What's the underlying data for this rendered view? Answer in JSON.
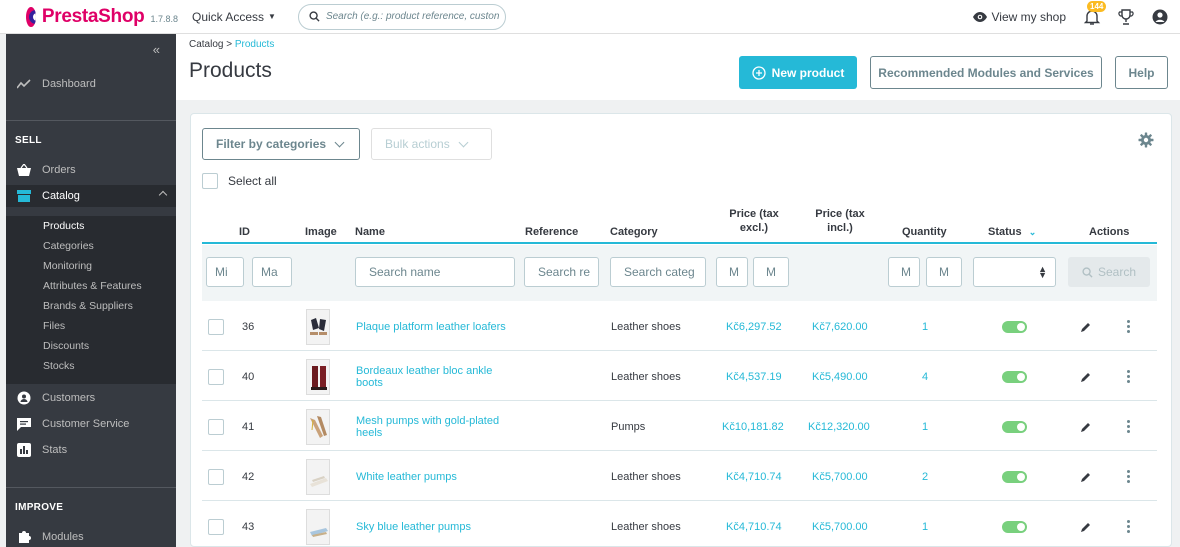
{
  "topbar": {
    "logo_text": "PrestaShop",
    "version": "1.7.8.8",
    "quick_access": "Quick Access",
    "search_placeholder": "Search (e.g.: product reference, custon",
    "view_shop": "View my shop",
    "notifications_count": "144"
  },
  "sidebar": {
    "dashboard": "Dashboard",
    "sell_heading": "SELL",
    "orders": "Orders",
    "catalog": "Catalog",
    "catalog_sub": [
      "Products",
      "Categories",
      "Monitoring",
      "Attributes & Features",
      "Brands & Suppliers",
      "Files",
      "Discounts",
      "Stocks"
    ],
    "customers": "Customers",
    "customer_service": "Customer Service",
    "stats": "Stats",
    "improve_heading": "IMPROVE",
    "modules": "Modules"
  },
  "header": {
    "breadcrumb_parent": "Catalog",
    "breadcrumb_sep": ">",
    "breadcrumb_current": "Products",
    "title": "Products",
    "new_product": "New product",
    "recommended": "Recommended Modules and Services",
    "help": "Help"
  },
  "toolbar": {
    "filter_categories": "Filter by categories",
    "bulk_actions": "Bulk actions",
    "select_all": "Select all"
  },
  "table": {
    "headers": {
      "id": "ID",
      "image": "Image",
      "name": "Name",
      "reference": "Reference",
      "category": "Category",
      "price_excl_1": "Price (tax",
      "price_excl_2": "excl.)",
      "price_incl_1": "Price (tax",
      "price_incl_2": "incl.)",
      "quantity": "Quantity",
      "status": "Status",
      "actions": "Actions"
    },
    "filters": {
      "id_min": "Mi",
      "id_max": "Ma",
      "name": "Search name",
      "reference": "Search re",
      "category": "Search categ",
      "price_min": "M",
      "price_max": "M",
      "qty_min": "M",
      "qty_max": "M",
      "search_button": "Search"
    },
    "rows": [
      {
        "id": "36",
        "name_1": "Plaque platform leather loafers",
        "name_2": "",
        "category": "Leather shoes",
        "price_excl": "Kč6,297.52",
        "price_incl": "Kč7,620.00",
        "quantity": "1"
      },
      {
        "id": "40",
        "name_1": "Bordeaux leather bloc ankle",
        "name_2": "boots",
        "category": "Leather shoes",
        "price_excl": "Kč4,537.19",
        "price_incl": "Kč5,490.00",
        "quantity": "4"
      },
      {
        "id": "41",
        "name_1": "Mesh pumps with gold-plated",
        "name_2": "heels",
        "category": "Pumps",
        "price_excl": "Kč10,181.82",
        "price_incl": "Kč12,320.00",
        "quantity": "1"
      },
      {
        "id": "42",
        "name_1": "White leather pumps",
        "name_2": "",
        "category": "Leather shoes",
        "price_excl": "Kč4,710.74",
        "price_incl": "Kč5,700.00",
        "quantity": "2"
      },
      {
        "id": "43",
        "name_1": "Sky blue leather pumps",
        "name_2": "",
        "category": "Leather shoes",
        "price_excl": "Kč4,710.74",
        "price_incl": "Kč5,700.00",
        "quantity": "1"
      }
    ]
  },
  "colors": {
    "accent": "#25b9d7",
    "sidebar_bg": "#363a41",
    "brand": "#df0067",
    "toggle_on": "#78d07d",
    "badge": "#fbbb22"
  }
}
